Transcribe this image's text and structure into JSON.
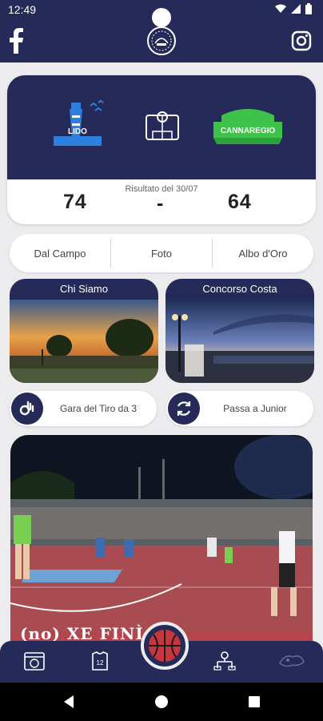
{
  "status_bar": {
    "time": "12:49"
  },
  "header": {
    "left_icon": "facebook-icon",
    "center_icon": "club-logo-icon",
    "right_icon": "instagram-icon"
  },
  "score": {
    "home_team": "LIDO",
    "away_team": "CANNAREGIO",
    "result_label": "Risultato del 30/07",
    "home_score": "74",
    "separator": "-",
    "away_score": "64"
  },
  "tabs": [
    {
      "label": "Dal Campo"
    },
    {
      "label": "Foto"
    },
    {
      "label": "Albo d'Oro"
    }
  ],
  "cards": [
    {
      "title": "Chi Siamo"
    },
    {
      "title": "Concorso Costa"
    }
  ],
  "actions": [
    {
      "label": "Gara del Tiro da 3",
      "icon": "ok-hand-icon"
    },
    {
      "label": "Passa a Junior",
      "icon": "refresh-icon"
    }
  ],
  "hero": {
    "caption": "(no) XE FINÌA"
  },
  "bottom_nav": [
    {
      "icon": "calendar-ball-icon"
    },
    {
      "icon": "team-jersey-icon"
    },
    {
      "icon": "basketball-icon"
    },
    {
      "icon": "bracket-icon"
    },
    {
      "icon": "trophy-icon"
    }
  ],
  "colors": {
    "navy": "#252a58",
    "lido_blue": "#2d7fe0",
    "cannaregio_green": "#3ec24a",
    "background": "#ececef"
  }
}
